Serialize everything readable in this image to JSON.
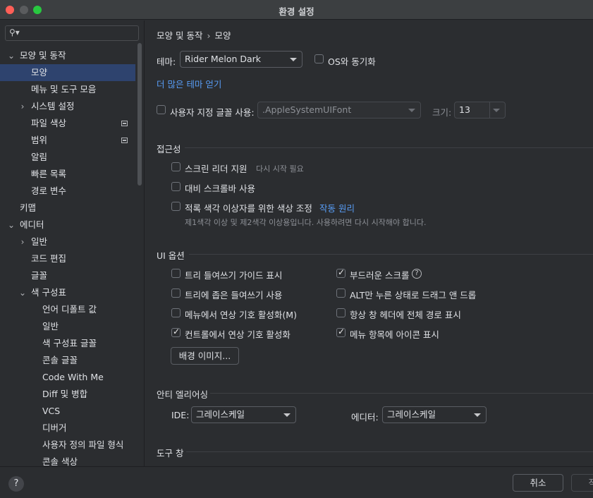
{
  "window": {
    "title": "환경 설정"
  },
  "sidebar": {
    "search_placeholder": "",
    "items": [
      {
        "label": "모양 및 동작",
        "expanded": true
      },
      {
        "label": "모양",
        "selected": true
      },
      {
        "label": "메뉴 및 도구 모음"
      },
      {
        "label": "시스템 설정",
        "expanded": false
      },
      {
        "label": "파일 색상"
      },
      {
        "label": "범위"
      },
      {
        "label": "알림"
      },
      {
        "label": "빠른 목록"
      },
      {
        "label": "경로 변수"
      },
      {
        "label": "키맵"
      },
      {
        "label": "에디터",
        "expanded": true
      },
      {
        "label": "일반",
        "expanded": false
      },
      {
        "label": "코드 편집"
      },
      {
        "label": "글꼴"
      },
      {
        "label": "색 구성표",
        "expanded": true
      },
      {
        "label": "언어 디폴트 값"
      },
      {
        "label": "일반"
      },
      {
        "label": "색 구성표 글꼴"
      },
      {
        "label": "콘솔 글꼴"
      },
      {
        "label": "Code With Me"
      },
      {
        "label": "Diff 및 병합"
      },
      {
        "label": "VCS"
      },
      {
        "label": "디버거"
      },
      {
        "label": "사용자 정의 파일 형식"
      },
      {
        "label": "콘솔 색상"
      }
    ]
  },
  "main": {
    "breadcrumb": {
      "parent": "모양 및 동작",
      "separator": "›",
      "current": "모양"
    },
    "theme": {
      "label": "테마:",
      "value": "Rider Melon Dark",
      "sync_os_label": "OS와 동기화",
      "sync_os_checked": false,
      "more_themes_link": "더 많은 테마 얻기"
    },
    "custom_font": {
      "label": "사용자 지정 글꼴 사용:",
      "checked": false,
      "font_value": ".AppleSystemUIFont",
      "size_label": "크기:",
      "size_value": "13"
    },
    "accessibility": {
      "title": "접근성",
      "screen_reader": {
        "label": "스크린 리더 지원",
        "hint": "다시 시작 필요",
        "checked": false
      },
      "contrast_scrollbars": {
        "label": "대비 스크롤바 사용",
        "checked": false
      },
      "color_deficiency": {
        "label": "적록 색각 이상자를 위한 색상 조정",
        "link": "작동 원리",
        "hint": "제1색각 이상 및 제2색각 이상용입니다. 사용하려면 다시 시작해야 합니다.",
        "checked": false
      }
    },
    "ui_options": {
      "title": "UI 옵션",
      "left": [
        {
          "label": "트리 들여쓰기 가이드 표시",
          "checked": false
        },
        {
          "label": "트리에 좁은 들여쓰기 사용",
          "checked": false
        },
        {
          "label": "메뉴에서 연상 기호 활성화(M)",
          "checked": false
        },
        {
          "label": "컨트롤에서 연상 기호 활성화",
          "checked": true
        }
      ],
      "right": [
        {
          "label": "부드러운 스크롤",
          "checked": true,
          "help": "?"
        },
        {
          "label": "ALT만 누른 상태로 드래그 앤 드롭",
          "checked": false
        },
        {
          "label": "항상 창 헤더에 전체 경로 표시",
          "checked": false
        },
        {
          "label": "메뉴 항목에 아이콘 표시",
          "checked": true
        }
      ],
      "background_button": "배경 이미지..."
    },
    "antialiasing": {
      "title": "안티 엘리어싱",
      "ide_label": "IDE:",
      "ide_value": "그레이스케일",
      "editor_label": "에디터:",
      "editor_value": "그레이스케일"
    },
    "tool_windows": {
      "title": "도구 창"
    }
  },
  "footer": {
    "help": "?",
    "cancel_label": "취소",
    "apply_label": "적용"
  },
  "colors": {
    "background": "#2b2d30",
    "selection": "#2e436e",
    "link": "#589df6",
    "titlebar": "#3c3f41"
  }
}
